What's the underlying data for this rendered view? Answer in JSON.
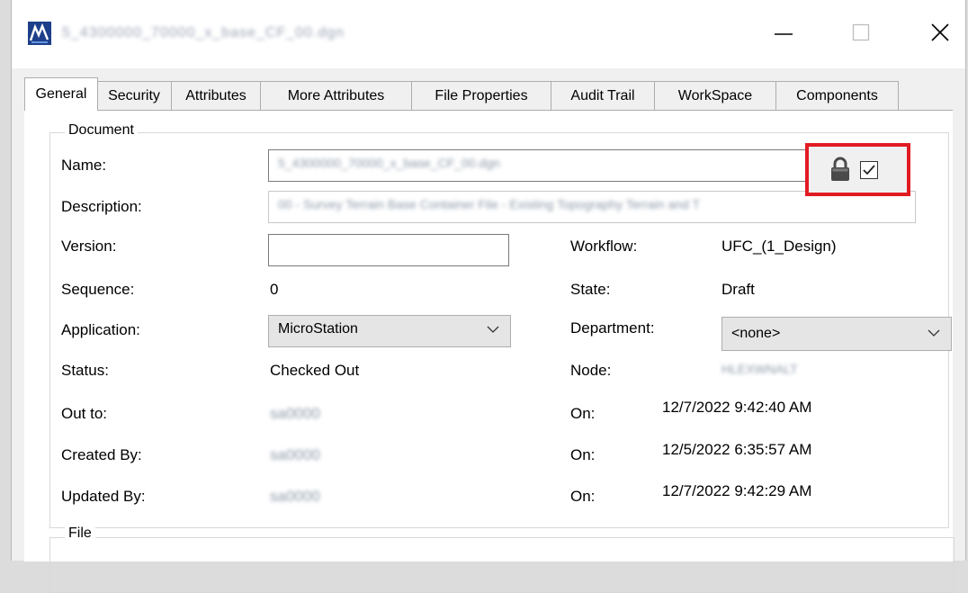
{
  "window": {
    "title": "5_4300000_70000_x_base_CF_00.dgn"
  },
  "tabs": [
    {
      "label": "General"
    },
    {
      "label": "Security"
    },
    {
      "label": "Attributes"
    },
    {
      "label": "More Attributes"
    },
    {
      "label": "File Properties"
    },
    {
      "label": "Audit Trail"
    },
    {
      "label": "WorkSpace"
    },
    {
      "label": "Components"
    }
  ],
  "document": {
    "group_title": "Document",
    "name_label": "Name:",
    "name_value": "5_4300000_70000_x_base_CF_00.dgn",
    "description_label": "Description:",
    "description_value": "00 - Survey Terrain Base Container File - Existing Topography Terrain and T",
    "version_label": "Version:",
    "version_value": "",
    "sequence_label": "Sequence:",
    "sequence_value": "0",
    "application_label": "Application:",
    "application_value": "MicroStation",
    "status_label": "Status:",
    "status_value": "Checked Out",
    "out_to_label": "Out to:",
    "out_to_value": "sa0000",
    "created_by_label": "Created By:",
    "created_by_value": "sa0000",
    "updated_by_label": "Updated By:",
    "updated_by_value": "sa0000",
    "workflow_label": "Workflow:",
    "workflow_value": "UFC_(1_Design)",
    "state_label": "State:",
    "state_value": "Draft",
    "department_label": "Department:",
    "department_value": "<none>",
    "node_label": "Node:",
    "node_value": "HLEXWNALT",
    "on_label": "On:",
    "out_on_value": "12/7/2022 9:42:40 AM",
    "created_on_value": "12/5/2022 6:35:57 AM",
    "updated_on_value": "12/7/2022 9:42:29 AM"
  },
  "file": {
    "group_title": "File"
  },
  "colors": {
    "highlight": "#e11b22",
    "window_bg": "#f0f0f0",
    "panel_bg": "#ffffff"
  }
}
